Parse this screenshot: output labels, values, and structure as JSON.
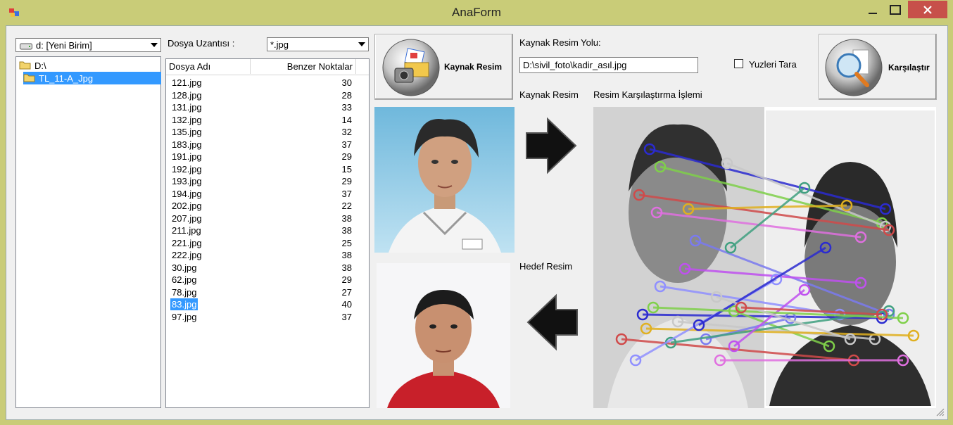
{
  "window": {
    "title": "AnaForm"
  },
  "drive_combo": {
    "value": "d: [Yeni Birim]"
  },
  "tree": {
    "items": [
      "D:\\",
      "TL_11-A_Jpg"
    ]
  },
  "extension": {
    "label": "Dosya Uzantısı :",
    "value": "*.jpg"
  },
  "list": {
    "columns": [
      "Dosya Adı",
      "Benzer Noktalar"
    ],
    "rows": [
      {
        "name": "121.jpg",
        "value": "30"
      },
      {
        "name": "128.jpg",
        "value": "28"
      },
      {
        "name": "131.jpg",
        "value": "33"
      },
      {
        "name": "132.jpg",
        "value": "14"
      },
      {
        "name": "135.jpg",
        "value": "32"
      },
      {
        "name": "183.jpg",
        "value": "37"
      },
      {
        "name": "191.jpg",
        "value": "29"
      },
      {
        "name": "192.jpg",
        "value": "15"
      },
      {
        "name": "193.jpg",
        "value": "29"
      },
      {
        "name": "194.jpg",
        "value": "37"
      },
      {
        "name": "202.jpg",
        "value": "22"
      },
      {
        "name": "207.jpg",
        "value": "38"
      },
      {
        "name": "211.jpg",
        "value": "38"
      },
      {
        "name": "221.jpg",
        "value": "25"
      },
      {
        "name": "222.jpg",
        "value": "38"
      },
      {
        "name": "30.jpg",
        "value": "38"
      },
      {
        "name": "62.jpg",
        "value": "29"
      },
      {
        "name": "78.jpg",
        "value": "27"
      },
      {
        "name": "83.jpg",
        "value": "40",
        "selected": true
      },
      {
        "name": "97.jpg",
        "value": "37"
      }
    ]
  },
  "source_button": {
    "label": "Kaynak Resim"
  },
  "source_path": {
    "label": "Kaynak Resim Yolu:",
    "value": "D:\\sivil_foto\\kadir_asıl.jpg"
  },
  "scan_faces": {
    "label": "Yuzleri Tara",
    "checked": false
  },
  "compare_button": {
    "label": "Karşılaştır"
  },
  "labels": {
    "source_image": "Kaynak Resim",
    "comparison": "Resim Karşılaştırma İşlemi",
    "target_image": "Hedef Resim"
  },
  "colors": {
    "frame": "#c9cc78",
    "selection": "#3399ff",
    "close": "#c7504a"
  }
}
